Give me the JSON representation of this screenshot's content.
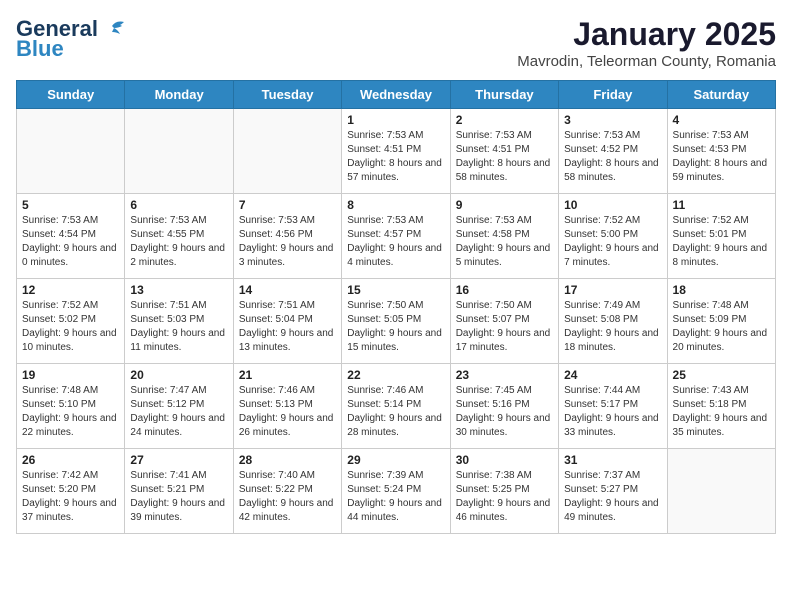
{
  "header": {
    "logo_line1": "General",
    "logo_line2": "Blue",
    "title": "January 2025",
    "subtitle": "Mavrodin, Teleorman County, Romania"
  },
  "weekdays": [
    "Sunday",
    "Monday",
    "Tuesday",
    "Wednesday",
    "Thursday",
    "Friday",
    "Saturday"
  ],
  "weeks": [
    [
      {
        "day": "",
        "info": ""
      },
      {
        "day": "",
        "info": ""
      },
      {
        "day": "",
        "info": ""
      },
      {
        "day": "1",
        "info": "Sunrise: 7:53 AM\nSunset: 4:51 PM\nDaylight: 8 hours and 57 minutes."
      },
      {
        "day": "2",
        "info": "Sunrise: 7:53 AM\nSunset: 4:51 PM\nDaylight: 8 hours and 58 minutes."
      },
      {
        "day": "3",
        "info": "Sunrise: 7:53 AM\nSunset: 4:52 PM\nDaylight: 8 hours and 58 minutes."
      },
      {
        "day": "4",
        "info": "Sunrise: 7:53 AM\nSunset: 4:53 PM\nDaylight: 8 hours and 59 minutes."
      }
    ],
    [
      {
        "day": "5",
        "info": "Sunrise: 7:53 AM\nSunset: 4:54 PM\nDaylight: 9 hours and 0 minutes."
      },
      {
        "day": "6",
        "info": "Sunrise: 7:53 AM\nSunset: 4:55 PM\nDaylight: 9 hours and 2 minutes."
      },
      {
        "day": "7",
        "info": "Sunrise: 7:53 AM\nSunset: 4:56 PM\nDaylight: 9 hours and 3 minutes."
      },
      {
        "day": "8",
        "info": "Sunrise: 7:53 AM\nSunset: 4:57 PM\nDaylight: 9 hours and 4 minutes."
      },
      {
        "day": "9",
        "info": "Sunrise: 7:53 AM\nSunset: 4:58 PM\nDaylight: 9 hours and 5 minutes."
      },
      {
        "day": "10",
        "info": "Sunrise: 7:52 AM\nSunset: 5:00 PM\nDaylight: 9 hours and 7 minutes."
      },
      {
        "day": "11",
        "info": "Sunrise: 7:52 AM\nSunset: 5:01 PM\nDaylight: 9 hours and 8 minutes."
      }
    ],
    [
      {
        "day": "12",
        "info": "Sunrise: 7:52 AM\nSunset: 5:02 PM\nDaylight: 9 hours and 10 minutes."
      },
      {
        "day": "13",
        "info": "Sunrise: 7:51 AM\nSunset: 5:03 PM\nDaylight: 9 hours and 11 minutes."
      },
      {
        "day": "14",
        "info": "Sunrise: 7:51 AM\nSunset: 5:04 PM\nDaylight: 9 hours and 13 minutes."
      },
      {
        "day": "15",
        "info": "Sunrise: 7:50 AM\nSunset: 5:05 PM\nDaylight: 9 hours and 15 minutes."
      },
      {
        "day": "16",
        "info": "Sunrise: 7:50 AM\nSunset: 5:07 PM\nDaylight: 9 hours and 17 minutes."
      },
      {
        "day": "17",
        "info": "Sunrise: 7:49 AM\nSunset: 5:08 PM\nDaylight: 9 hours and 18 minutes."
      },
      {
        "day": "18",
        "info": "Sunrise: 7:48 AM\nSunset: 5:09 PM\nDaylight: 9 hours and 20 minutes."
      }
    ],
    [
      {
        "day": "19",
        "info": "Sunrise: 7:48 AM\nSunset: 5:10 PM\nDaylight: 9 hours and 22 minutes."
      },
      {
        "day": "20",
        "info": "Sunrise: 7:47 AM\nSunset: 5:12 PM\nDaylight: 9 hours and 24 minutes."
      },
      {
        "day": "21",
        "info": "Sunrise: 7:46 AM\nSunset: 5:13 PM\nDaylight: 9 hours and 26 minutes."
      },
      {
        "day": "22",
        "info": "Sunrise: 7:46 AM\nSunset: 5:14 PM\nDaylight: 9 hours and 28 minutes."
      },
      {
        "day": "23",
        "info": "Sunrise: 7:45 AM\nSunset: 5:16 PM\nDaylight: 9 hours and 30 minutes."
      },
      {
        "day": "24",
        "info": "Sunrise: 7:44 AM\nSunset: 5:17 PM\nDaylight: 9 hours and 33 minutes."
      },
      {
        "day": "25",
        "info": "Sunrise: 7:43 AM\nSunset: 5:18 PM\nDaylight: 9 hours and 35 minutes."
      }
    ],
    [
      {
        "day": "26",
        "info": "Sunrise: 7:42 AM\nSunset: 5:20 PM\nDaylight: 9 hours and 37 minutes."
      },
      {
        "day": "27",
        "info": "Sunrise: 7:41 AM\nSunset: 5:21 PM\nDaylight: 9 hours and 39 minutes."
      },
      {
        "day": "28",
        "info": "Sunrise: 7:40 AM\nSunset: 5:22 PM\nDaylight: 9 hours and 42 minutes."
      },
      {
        "day": "29",
        "info": "Sunrise: 7:39 AM\nSunset: 5:24 PM\nDaylight: 9 hours and 44 minutes."
      },
      {
        "day": "30",
        "info": "Sunrise: 7:38 AM\nSunset: 5:25 PM\nDaylight: 9 hours and 46 minutes."
      },
      {
        "day": "31",
        "info": "Sunrise: 7:37 AM\nSunset: 5:27 PM\nDaylight: 9 hours and 49 minutes."
      },
      {
        "day": "",
        "info": ""
      }
    ]
  ]
}
